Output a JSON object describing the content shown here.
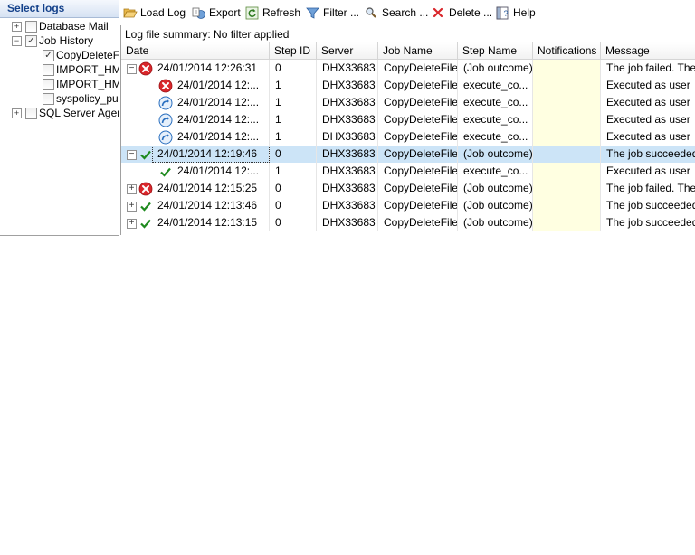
{
  "left_panel": {
    "header": "Select logs",
    "tree": [
      {
        "label": "Database Mail",
        "expander": "+",
        "checked": false
      },
      {
        "label": "Job History",
        "expander": "−",
        "checked": true
      },
      {
        "label": "CopyDeleteFile",
        "checked": true
      },
      {
        "label": "IMPORT_HML",
        "checked": false
      },
      {
        "label": "IMPORT_HML",
        "checked": false
      },
      {
        "label": "syspolicy_purg",
        "checked": false
      },
      {
        "label": "SQL Server Agent",
        "expander": "+",
        "checked": false
      }
    ]
  },
  "toolbar": {
    "load_log": "Load Log",
    "export": "Export",
    "refresh": "Refresh",
    "filter": "Filter ...",
    "search": "Search ...",
    "delete": "Delete ...",
    "help": "Help"
  },
  "summary": "Log file summary: No filter applied",
  "columns": [
    "Date",
    "Step ID",
    "Server",
    "Job Name",
    "Step Name",
    "Notifications",
    "Message"
  ],
  "rows": [
    {
      "expander": "−",
      "icon": "error-icon",
      "date": "24/01/2014 12:26:31",
      "step_id": "0",
      "server": "DHX33683",
      "job": "CopyDeleteFile",
      "step": "(Job outcome)",
      "notif": "",
      "msg": "The job failed.  The"
    },
    {
      "icon": "error-icon",
      "date": "24/01/2014 12:...",
      "step_id": "1",
      "server": "DHX33683",
      "job": "CopyDeleteFile",
      "step": "execute_co...",
      "notif": "",
      "msg": "Executed as user"
    },
    {
      "icon": "retry-icon",
      "date": "24/01/2014 12:...",
      "step_id": "1",
      "server": "DHX33683",
      "job": "CopyDeleteFile",
      "step": "execute_co...",
      "notif": "",
      "msg": "Executed as user"
    },
    {
      "icon": "retry-icon",
      "date": "24/01/2014 12:...",
      "step_id": "1",
      "server": "DHX33683",
      "job": "CopyDeleteFile",
      "step": "execute_co...",
      "notif": "",
      "msg": "Executed as user"
    },
    {
      "icon": "retry-icon",
      "date": "24/01/2014 12:...",
      "step_id": "1",
      "server": "DHX33683",
      "job": "CopyDeleteFile",
      "step": "execute_co...",
      "notif": "",
      "msg": "Executed as user"
    },
    {
      "expander": "−",
      "icon": "success-icon",
      "date": "24/01/2014 12:19:46",
      "step_id": "0",
      "server": "DHX33683",
      "job": "CopyDeleteFile",
      "step": "(Job outcome)",
      "notif": "",
      "msg": "The job succeeded",
      "selected": true
    },
    {
      "icon": "success-icon",
      "date": "24/01/2014 12:...",
      "step_id": "1",
      "server": "DHX33683",
      "job": "CopyDeleteFile",
      "step": "execute_co...",
      "notif": "",
      "msg": "Executed as user"
    },
    {
      "expander": "+",
      "icon": "error-icon",
      "date": "24/01/2014 12:15:25",
      "step_id": "0",
      "server": "DHX33683",
      "job": "CopyDeleteFile",
      "step": "(Job outcome)",
      "notif": "",
      "msg": "The job failed.  The"
    },
    {
      "expander": "+",
      "icon": "success-icon",
      "date": "24/01/2014 12:13:46",
      "step_id": "0",
      "server": "DHX33683",
      "job": "CopyDeleteFile",
      "step": "(Job outcome)",
      "notif": "",
      "msg": "The job succeeded"
    },
    {
      "expander": "+",
      "icon": "success-icon",
      "date": "24/01/2014 12:13:15",
      "step_id": "0",
      "server": "DHX33683",
      "job": "CopyDeleteFile",
      "step": "(Job outcome)",
      "notif": "",
      "msg": "The job succeeded"
    }
  ],
  "colors": {
    "selected_row": "#cce4f7",
    "notifications_bg": "#ffffe1",
    "error": "#d9262b",
    "success": "#1e8a1e",
    "retry": "#2a6fbf"
  }
}
